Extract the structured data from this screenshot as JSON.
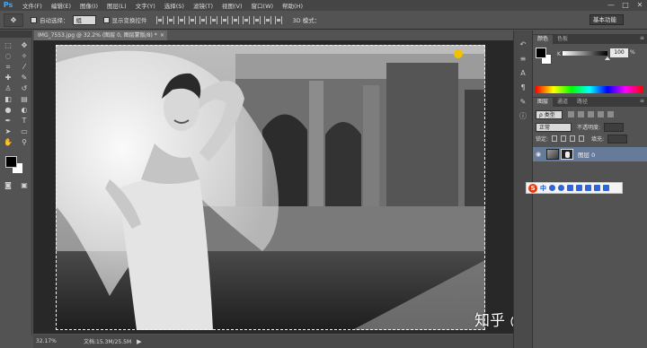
{
  "app": {
    "logo": "Ps"
  },
  "menu": {
    "items": [
      "文件(F)",
      "编辑(E)",
      "图像(I)",
      "图层(L)",
      "文字(Y)",
      "选择(S)",
      "滤镜(T)",
      "视图(V)",
      "窗口(W)",
      "帮助(H)"
    ]
  },
  "window_controls": {
    "minimize": "—",
    "maximize": "□",
    "close": "✕"
  },
  "options": {
    "tool_icon": "move-tool-icon",
    "tool_glyph": "✥",
    "auto_select_label": "自动选择：",
    "auto_select_value": "组",
    "transform_label": "显示变换控件",
    "mode_3d_label": "3D 模式：",
    "workspace": "基本功能"
  },
  "toolbox": {
    "tools": [
      {
        "icon": "rect-marquee-icon",
        "glyph": "⬚"
      },
      {
        "icon": "move-icon",
        "glyph": "✥"
      },
      {
        "icon": "lasso-icon",
        "glyph": "◌"
      },
      {
        "icon": "magic-wand-icon",
        "glyph": "✧"
      },
      {
        "icon": "crop-icon",
        "glyph": "⌗"
      },
      {
        "icon": "eyedropper-icon",
        "glyph": "⁄"
      },
      {
        "icon": "healing-brush-icon",
        "glyph": "✚"
      },
      {
        "icon": "brush-icon",
        "glyph": "✎"
      },
      {
        "icon": "clone-stamp-icon",
        "glyph": "♙"
      },
      {
        "icon": "history-brush-icon",
        "glyph": "↺"
      },
      {
        "icon": "eraser-icon",
        "glyph": "◧"
      },
      {
        "icon": "gradient-icon",
        "glyph": "▤"
      },
      {
        "icon": "blur-icon",
        "glyph": "●"
      },
      {
        "icon": "dodge-icon",
        "glyph": "◐"
      },
      {
        "icon": "pen-icon",
        "glyph": "✒"
      },
      {
        "icon": "type-icon",
        "glyph": "T"
      },
      {
        "icon": "path-select-icon",
        "glyph": "➤"
      },
      {
        "icon": "rectangle-shape-icon",
        "glyph": "▭"
      },
      {
        "icon": "hand-icon",
        "glyph": "✋"
      },
      {
        "icon": "zoom-icon",
        "glyph": "⚲"
      }
    ],
    "extra": [
      {
        "icon": "quick-mask-icon",
        "glyph": "◙"
      },
      {
        "icon": "screen-mode-icon",
        "glyph": "▣"
      }
    ]
  },
  "document": {
    "tab_title": "IMG_7553.jpg @ 32.2% (图层 0, 图层蒙版/8) *",
    "close": "×"
  },
  "watermark": "知乎 @设计师后言",
  "status": {
    "zoom": "32.17%",
    "doc_info": "文档:15.3M/25.5M",
    "arrow": "▶"
  },
  "dock": {
    "buttons": [
      {
        "icon": "history-panel-icon",
        "glyph": "↶"
      },
      {
        "icon": "properties-panel-icon",
        "glyph": "≡"
      },
      {
        "icon": "character-panel-icon",
        "glyph": "A"
      },
      {
        "icon": "paragraph-panel-icon",
        "glyph": "¶"
      },
      {
        "icon": "brush-panel-icon",
        "glyph": "✎"
      },
      {
        "icon": "info-panel-icon",
        "glyph": "ⓘ"
      }
    ]
  },
  "color_panel": {
    "tabs": [
      "颜色",
      "色板"
    ],
    "channel": "K",
    "value": "100",
    "value_fraction": 1.0,
    "unit": "%",
    "menu": "≡"
  },
  "layers_panel": {
    "tabs": [
      "图层",
      "通道",
      "路径"
    ],
    "menu": "≡",
    "filter_kind": "ρ 类型",
    "blend_mode": "正常",
    "opacity_label": "不透明度:",
    "opacity_value": "",
    "lock_label": "锁定:",
    "fill_label": "填充:",
    "fill_value": "",
    "layer_name": "图层 0",
    "eye": "◉"
  },
  "ime": {
    "logo": "S",
    "mode": "中"
  },
  "colors": {
    "accent": "#667b9a",
    "panel": "#535353",
    "menubar": "#454545"
  }
}
